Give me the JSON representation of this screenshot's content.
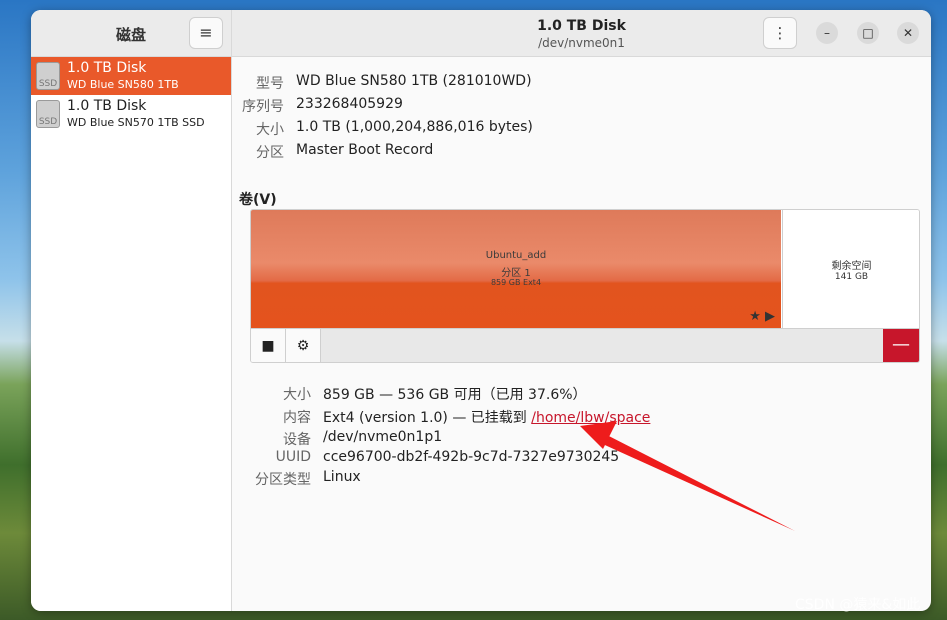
{
  "sidebar": {
    "title": "磁盘",
    "menu_icon": "≡",
    "disks": [
      {
        "name": "1.0 TB Disk",
        "model": "WD Blue SN580 1TB",
        "icon_label": "SSD",
        "selected": true
      },
      {
        "name": "1.0 TB Disk",
        "model": "WD Blue SN570 1TB SSD",
        "icon_label": "SSD",
        "selected": false
      }
    ]
  },
  "header": {
    "title": "1.0 TB Disk",
    "subtitle": "/dev/nvme0n1",
    "kebab_icon": "⋮",
    "minimize": "–",
    "maximize": "□",
    "close": "✕"
  },
  "disk_info": [
    {
      "label": "型号",
      "value": "WD Blue SN580 1TB (281010WD)"
    },
    {
      "label": "序列号",
      "value": "233268405929"
    },
    {
      "label": "大小",
      "value": "1.0 TB (1,000,204,886,016 bytes)"
    },
    {
      "label": "分区",
      "value": "Master Boot Record"
    }
  ],
  "volumes": {
    "title": "卷(V)",
    "partition": {
      "name": "Ubuntu_add",
      "number": "分区 1",
      "size": "859 GB Ext4"
    },
    "free_space": {
      "label": "剩余空间",
      "size": "141 GB"
    },
    "toolbar": {
      "stop_icon": "■",
      "gear_icon": "⚙",
      "delete_icon": "—"
    }
  },
  "partition_info": {
    "size_label": "大小",
    "size_value": "859 GB — 536 GB 可用（已用 37.6%）",
    "content_label": "内容",
    "content_prefix": "Ext4 (version 1.0) — 已挂载到 ",
    "content_link": "/home/lbw/space",
    "device_label": "设备",
    "device_value": "/dev/nvme0n1p1",
    "uuid_label": "UUID",
    "uuid_value": "cce96700-db2f-492b-9c7d-7327e9730245",
    "type_label": "分区类型",
    "type_value": "Linux"
  },
  "watermark": "CSDN @猿来&如此",
  "colors": {
    "accent": "#e9592a",
    "danger": "#c7162b",
    "arrow": "#ee1c1c"
  }
}
